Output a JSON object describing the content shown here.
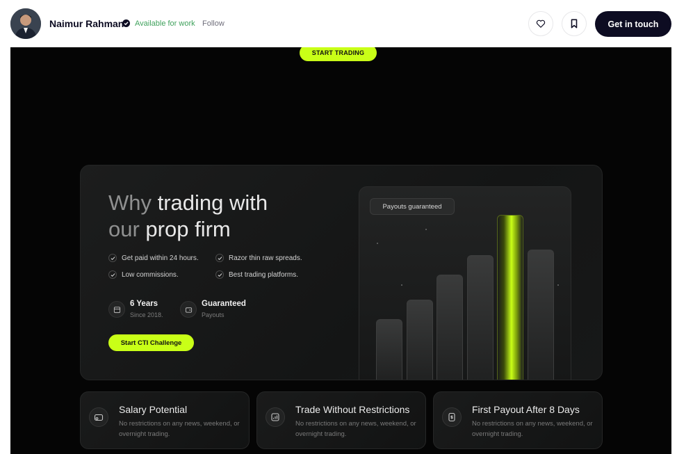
{
  "header": {
    "author_name": "Naimur Rahman",
    "availability": "Available for work",
    "follow_label": "Follow",
    "like_icon": "heart-icon",
    "save_icon": "bookmark-icon",
    "cta_label": "Get in touch"
  },
  "shot": {
    "top_button": "START TRADING",
    "hero": {
      "title_line1_dim": "Why",
      "title_line1_rest": " trading with",
      "title_line2_dim": "our",
      "title_line2_rest": " prop firm",
      "features": [
        "Get paid within 24 hours.",
        "Razor thin raw spreads.",
        "Low commissions.",
        "Best trading platforms."
      ],
      "stats": [
        {
          "value": "6 Years",
          "sub": "Since 2018.",
          "icon": "calendar-icon"
        },
        {
          "value": "Guaranteed",
          "sub": "Payouts",
          "icon": "wallet-icon"
        }
      ],
      "challenge_button": "Start CTI Challenge",
      "chart_badge": "Payouts guaranteed"
    },
    "cards": [
      {
        "title": "Salary Potential",
        "desc": "No restrictions on any news, weekend, or overnight trading.",
        "icon": "wallet-icon"
      },
      {
        "title": "Trade Without Restrictions",
        "desc": "No restrictions on any news, weekend, or overnight trading.",
        "icon": "chart-icon"
      },
      {
        "title": "First Payout After 8 Days",
        "desc": "No restrictions on any news, weekend, or overnight trading.",
        "icon": "dollar-icon"
      }
    ]
  },
  "colors": {
    "accent": "#c9ff17",
    "background": "#050505",
    "cta": "#0d0c22",
    "available": "#3fa15c"
  }
}
